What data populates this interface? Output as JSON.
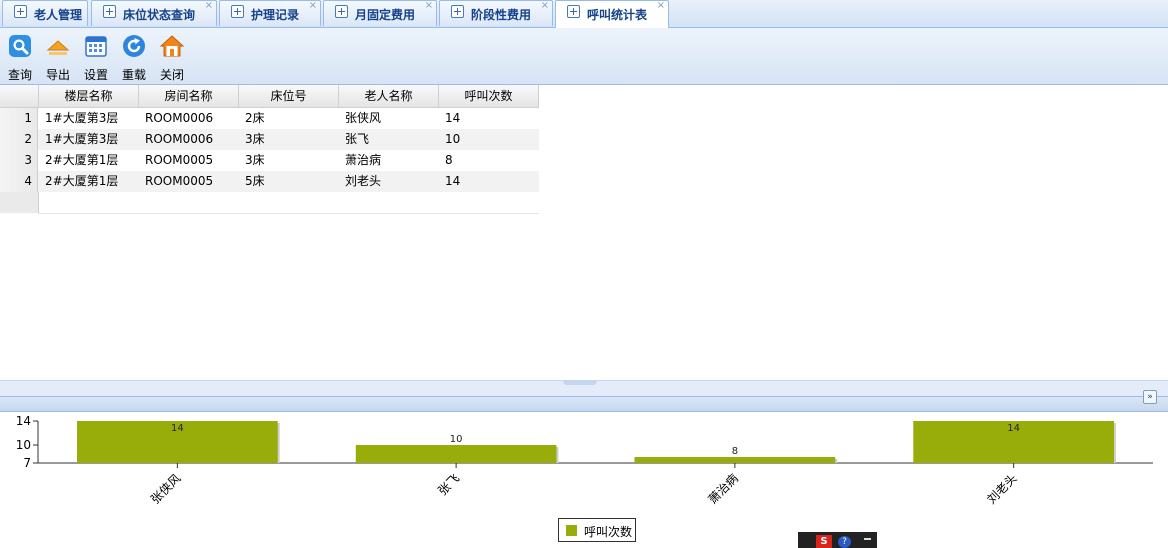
{
  "tabs": [
    {
      "label": "老人管理",
      "closable": false,
      "active": false
    },
    {
      "label": "床位状态查询",
      "closable": true,
      "active": false
    },
    {
      "label": "护理记录",
      "closable": true,
      "active": false
    },
    {
      "label": "月固定费用",
      "closable": true,
      "active": false
    },
    {
      "label": "阶段性费用",
      "closable": true,
      "active": false
    },
    {
      "label": "呼叫统计表",
      "closable": true,
      "active": true
    }
  ],
  "tab_close_glyph": "×",
  "toolbar": {
    "query": "查询",
    "export": "导出",
    "settings": "设置",
    "reload": "重载",
    "close": "关闭"
  },
  "grid": {
    "columns": [
      "楼层名称",
      "房间名称",
      "床位号",
      "老人名称",
      "呼叫次数"
    ],
    "rows": [
      {
        "n": "1",
        "floor": "1#大厦第3层",
        "room": "ROOM0006",
        "bed": "2床",
        "name": "张侠风",
        "calls": "14"
      },
      {
        "n": "2",
        "floor": "1#大厦第3层",
        "room": "ROOM0006",
        "bed": "3床",
        "name": "张飞",
        "calls": "10"
      },
      {
        "n": "3",
        "floor": "2#大厦第1层",
        "room": "ROOM0005",
        "bed": "3床",
        "name": "萧治病",
        "calls": "8"
      },
      {
        "n": "4",
        "floor": "2#大厦第1层",
        "room": "ROOM0005",
        "bed": "5床",
        "name": "刘老头",
        "calls": "14"
      }
    ]
  },
  "collapse_glyph": "»",
  "chart_data": {
    "type": "bar",
    "categories": [
      "张侠风",
      "张飞",
      "萧治病",
      "刘老头"
    ],
    "series": [
      {
        "name": "呼叫次数",
        "values": [
          14,
          10,
          8,
          14
        ]
      }
    ],
    "yticks": [
      7,
      10,
      14
    ],
    "ylim": [
      7,
      14
    ],
    "legend": "bottom-center",
    "color": "#99ad0a"
  },
  "ime": {
    "s": "S",
    "q": "?"
  }
}
